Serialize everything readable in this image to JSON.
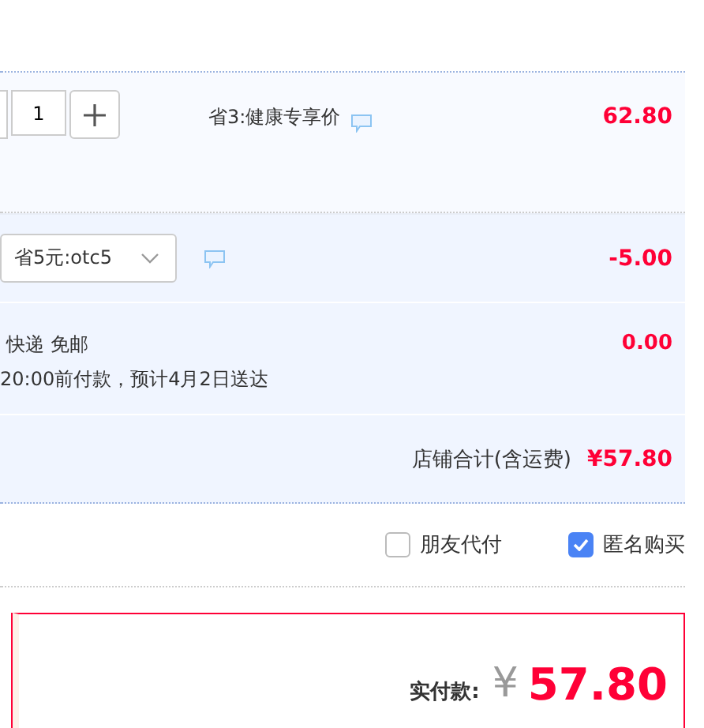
{
  "item": {
    "quantity": "1",
    "promo": "省3:健康专享价",
    "price": "62.80"
  },
  "coupon": {
    "value": "省5元:otc5",
    "amount": "-5.00"
  },
  "delivery": {
    "method": "快递 免邮",
    "note": "20:00前付款，预计4月2日送达",
    "fee": "0.00"
  },
  "shop_total": {
    "label": "店铺合计(含运费)",
    "amount": "¥57.80"
  },
  "options": [
    {
      "label": "朋友代付",
      "checked": false
    },
    {
      "label": "匿名购买",
      "checked": true
    }
  ],
  "payment": {
    "label": "实付款:",
    "currency": "¥",
    "amount": "57.80"
  }
}
